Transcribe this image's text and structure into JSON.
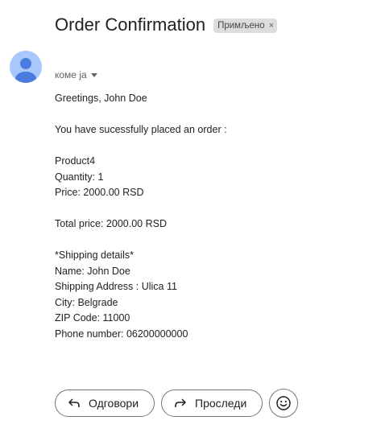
{
  "email": {
    "subject": "Order Confirmation",
    "label": "Примљено",
    "label_close": "×",
    "recipient": "коме ја",
    "body_lines": [
      "Greetings, John Doe",
      "",
      "You have sucessfully placed an order :",
      "",
      "Product4",
      "Quantity: 1",
      "Price: 2000.00 RSD",
      "",
      "Total price: 2000.00 RSD",
      "",
      "*Shipping details*",
      "Name: John Doe",
      "Shipping Address : Ulica 11",
      "City: Belgrade",
      "ZIP Code: 11000",
      "Phone number: 06200000000"
    ]
  },
  "actions": {
    "reply_label": "Одговори",
    "forward_label": "Проследи"
  },
  "icons": {
    "avatar": "person-icon",
    "recipient_caret": "caret-down-icon",
    "reply": "reply-arrow-icon",
    "forward": "forward-arrow-icon",
    "emoji": "smiley-icon"
  },
  "colors": {
    "avatar_bg": "#a8c7fa",
    "avatar_fg": "#4a7be0",
    "label_chip": "#dddddd"
  }
}
